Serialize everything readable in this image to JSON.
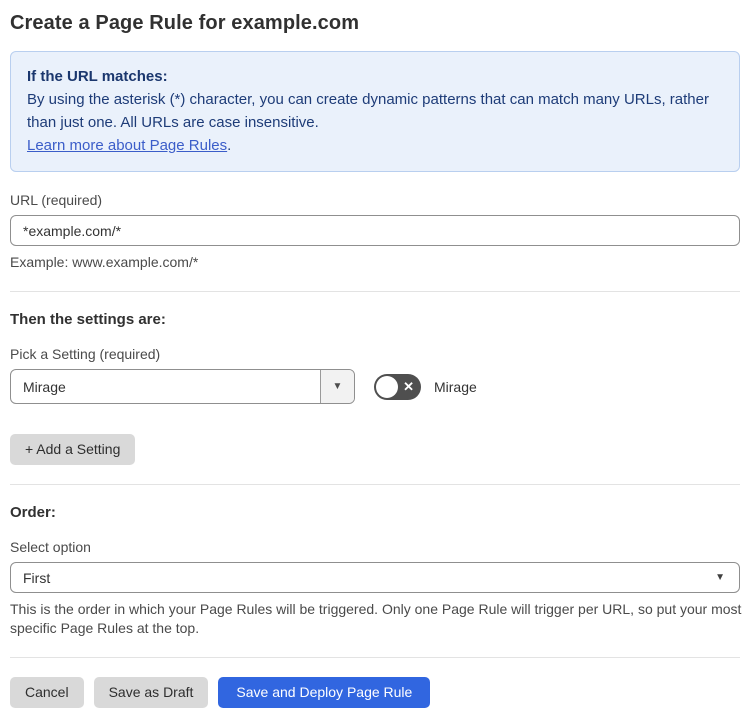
{
  "page": {
    "title": "Create a Page Rule for example.com"
  },
  "info_box": {
    "heading": "If the URL matches:",
    "body": "By using the asterisk (*) character, you can create dynamic patterns that can match many URLs, rather than just one. All URLs are case insensitive.",
    "link_label": "Learn more about Page Rules",
    "link_suffix": "."
  },
  "url_field": {
    "label": "URL (required)",
    "value": "*example.com/*",
    "helper": "Example: www.example.com/*"
  },
  "settings_section": {
    "heading": "Then the settings are:",
    "picker_label": "Pick a Setting (required)",
    "picker_value": "Mirage",
    "toggle_label": "Mirage",
    "toggle_state": "off",
    "add_button_label": "+ Add a Setting"
  },
  "order_section": {
    "heading": "Order:",
    "select_label": "Select option",
    "select_value": "First",
    "helper": "This is the order in which your Page Rules will be triggered. Only one Page Rule will trigger per URL, so put your most specific Page Rules at the top."
  },
  "footer": {
    "cancel_label": "Cancel",
    "save_draft_label": "Save as Draft",
    "save_deploy_label": "Save and Deploy Page Rule"
  },
  "icons": {
    "dropdown_arrow": "▼",
    "toggle_off_x": "✕"
  },
  "colors": {
    "info_box_bg": "#eaf1fb",
    "info_box_border": "#b9cfef",
    "info_text": "#1e3c78",
    "link_blue": "#3b5dc9",
    "primary_button_blue": "#3166e0",
    "gray_button_bg": "#d9d9d9",
    "toggle_off_gray": "#4f4f4f"
  }
}
